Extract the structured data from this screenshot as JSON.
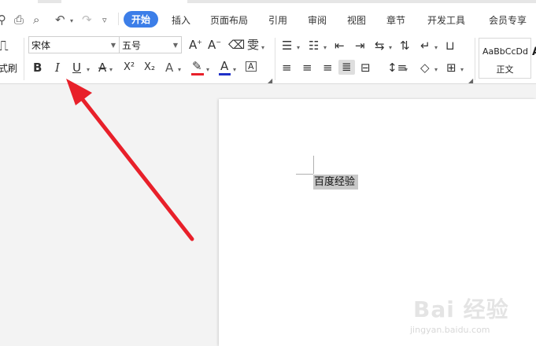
{
  "tabs": [
    "开始",
    "插入",
    "页面布局",
    "引用",
    "审阅",
    "视图",
    "章节",
    "开发工具",
    "会员专享"
  ],
  "active_tab": "开始",
  "font": {
    "name": "宋体",
    "size": "五号"
  },
  "left_label": "式刷",
  "format_icons": [
    "B",
    "I",
    "U",
    "A",
    "X²",
    "X₂",
    "A"
  ],
  "style_preview": {
    "sample": "AaBbCcDd",
    "name": "正文",
    "next_glyph": "A"
  },
  "document": {
    "selected_text": "百度经验"
  },
  "watermark": {
    "brand": "Bai 经验",
    "url": "jingyan.baidu.com"
  },
  "colors": {
    "tab_active": "#3c7ee8",
    "arrow": "#e8202a",
    "highlight": "#c8c8c8",
    "font_color_bar": "#e8202a"
  }
}
